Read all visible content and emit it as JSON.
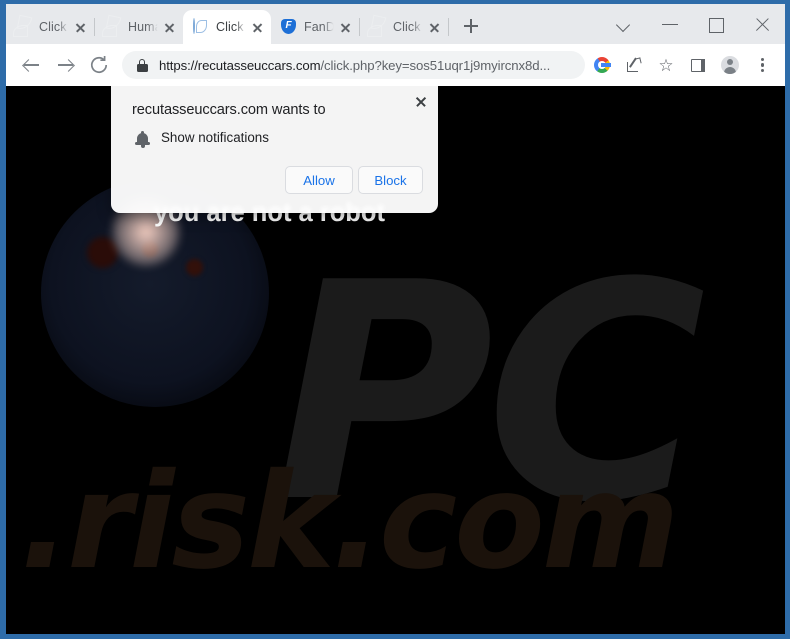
{
  "window": {
    "frame_color": "#2e6ca9",
    "controls": {
      "tab_search_label": "tab-search-chevron",
      "minimize_label": "minimize",
      "maximize_label": "maximize",
      "close_label": "close"
    }
  },
  "tabstrip": {
    "new_tab_label": "+",
    "tabs": [
      {
        "title": "Click A",
        "favicon": "globe-icon",
        "active": false
      },
      {
        "title": "Humar",
        "favicon": "globe-icon",
        "active": false
      },
      {
        "title": "Click \"",
        "favicon": "globe-blue-icon",
        "active": true
      },
      {
        "title": "FanDu",
        "favicon": "fanduel-shield-icon",
        "active": false
      },
      {
        "title": "Click A",
        "favicon": "globe-icon",
        "active": false
      }
    ]
  },
  "toolbar": {
    "back_label": "back-arrow-icon",
    "forward_label": "forward-arrow-icon",
    "reload_label": "reload-icon",
    "security_icon": "lock-icon",
    "url_host": "https://recutasseuccars.com",
    "url_path": "/click.php?key=sos51uqr1j9myircnx8d...",
    "url_full": "https://recutasseuccars.com/click.php?key=sos51uqr1j9myircnx8d...",
    "icons": [
      {
        "name": "google-icon",
        "label": "G"
      },
      {
        "name": "share-icon",
        "label": "share"
      },
      {
        "name": "bookmark-star-icon",
        "label": "☆"
      },
      {
        "name": "side-panel-icon",
        "label": "side panel"
      },
      {
        "name": "profile-avatar-icon",
        "label": "profile"
      },
      {
        "name": "three-dot-menu-icon",
        "label": "⋮"
      }
    ]
  },
  "page": {
    "background_color": "#000000",
    "headline": "you are not a robot",
    "headline_color": "#ffffff",
    "watermark_primary": "PC",
    "watermark_secondary": ".risk.com",
    "watermark_color": "#1b1b1b"
  },
  "permission_dialog": {
    "title": "recutasseuccars.com wants to",
    "permission_icon": "bell-icon",
    "permission_label": "Show notifications",
    "allow_label": "Allow",
    "block_label": "Block",
    "close_label": "×",
    "accent_color": "#1a73e8"
  }
}
